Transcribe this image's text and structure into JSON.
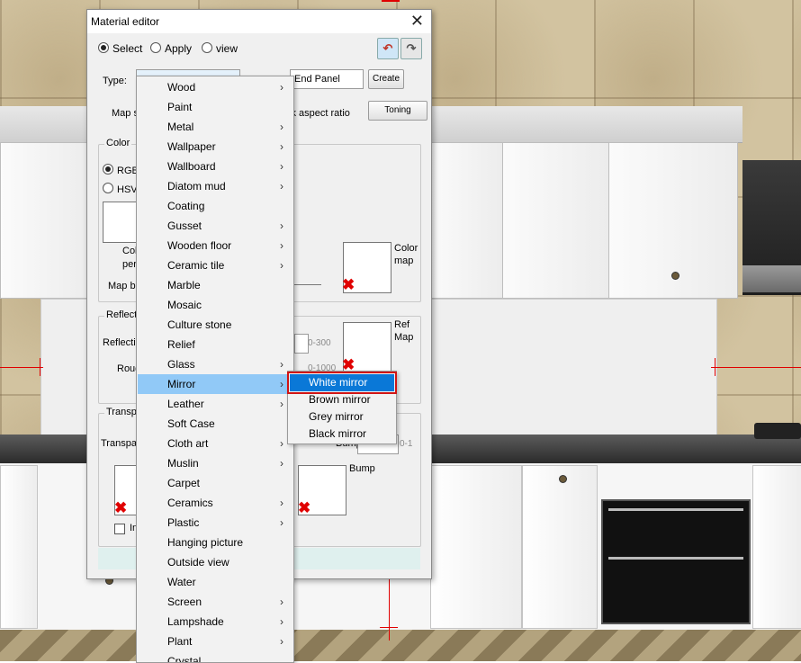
{
  "dialog": {
    "title": "Material editor",
    "mode_select": "Select",
    "mode_apply": "Apply",
    "mode_view": "view",
    "type_label": "Type:",
    "name_value": "End Panel",
    "create_button": "Create",
    "map_size_label": "Map s",
    "lock_aspect_label": "ck aspect ratio",
    "toning_button": "Toning",
    "color_group": "Color",
    "rgb_label": "RGB",
    "hsv_label": "HSV",
    "color_text_1": "Col",
    "color_text_2": "per",
    "map_b_label": "Map b",
    "color_map_label_1": "Color",
    "color_map_label_2": "map",
    "reflect_group": "Reflect",
    "reflect_field_label": "Reflecti",
    "range_reflect": "0-300",
    "rough_label": "Roug",
    "range_rough": "0-1000",
    "ref_map_label_1": "Ref",
    "ref_map_label_2": "Map",
    "transp_group": "Transp",
    "transp_field_label": "Transpa",
    "bump_field_label": "Bump",
    "range_bump": "0-1",
    "bump_label": "Bump",
    "invert_label": "In"
  },
  "type_menu": {
    "items": [
      {
        "label": "Wood",
        "submenu": true
      },
      {
        "label": "Paint",
        "submenu": false
      },
      {
        "label": "Metal",
        "submenu": true
      },
      {
        "label": "Wallpaper",
        "submenu": true
      },
      {
        "label": "Wallboard",
        "submenu": true
      },
      {
        "label": "Diatom mud",
        "submenu": true
      },
      {
        "label": "Coating",
        "submenu": false
      },
      {
        "label": "Gusset",
        "submenu": true
      },
      {
        "label": "Wooden floor",
        "submenu": true
      },
      {
        "label": "Ceramic tile",
        "submenu": true
      },
      {
        "label": "Marble",
        "submenu": false
      },
      {
        "label": "Mosaic",
        "submenu": false
      },
      {
        "label": "Culture stone",
        "submenu": false
      },
      {
        "label": "Relief",
        "submenu": false
      },
      {
        "label": "Glass",
        "submenu": true
      },
      {
        "label": "Mirror",
        "submenu": true,
        "selected": true
      },
      {
        "label": "Leather",
        "submenu": true
      },
      {
        "label": "Soft Case",
        "submenu": false
      },
      {
        "label": "Cloth art",
        "submenu": true
      },
      {
        "label": "Muslin",
        "submenu": true
      },
      {
        "label": "Carpet",
        "submenu": false
      },
      {
        "label": "Ceramics",
        "submenu": true
      },
      {
        "label": "Plastic",
        "submenu": true
      },
      {
        "label": "Hanging picture",
        "submenu": false
      },
      {
        "label": "Outside view",
        "submenu": false
      },
      {
        "label": "Water",
        "submenu": false
      },
      {
        "label": "Screen",
        "submenu": true
      },
      {
        "label": "Lampshade",
        "submenu": true
      },
      {
        "label": "Plant",
        "submenu": true
      },
      {
        "label": "Crystal",
        "submenu": false
      }
    ]
  },
  "mirror_submenu": {
    "items": [
      {
        "label": "White mirror",
        "selected": true
      },
      {
        "label": "Brown mirror"
      },
      {
        "label": "Grey mirror"
      },
      {
        "label": "Black mirror"
      }
    ]
  },
  "icons": {
    "submenu_arrow": "chevron-right-icon",
    "undo": "undo-arrow-icon",
    "redo": "redo-arrow-icon",
    "close": "close-icon",
    "missing_map": "red-x-icon"
  },
  "colors": {
    "menu_highlight": "#91c9f7",
    "submenu_highlight": "#0a78d7",
    "annotation_red": "#d01414"
  }
}
